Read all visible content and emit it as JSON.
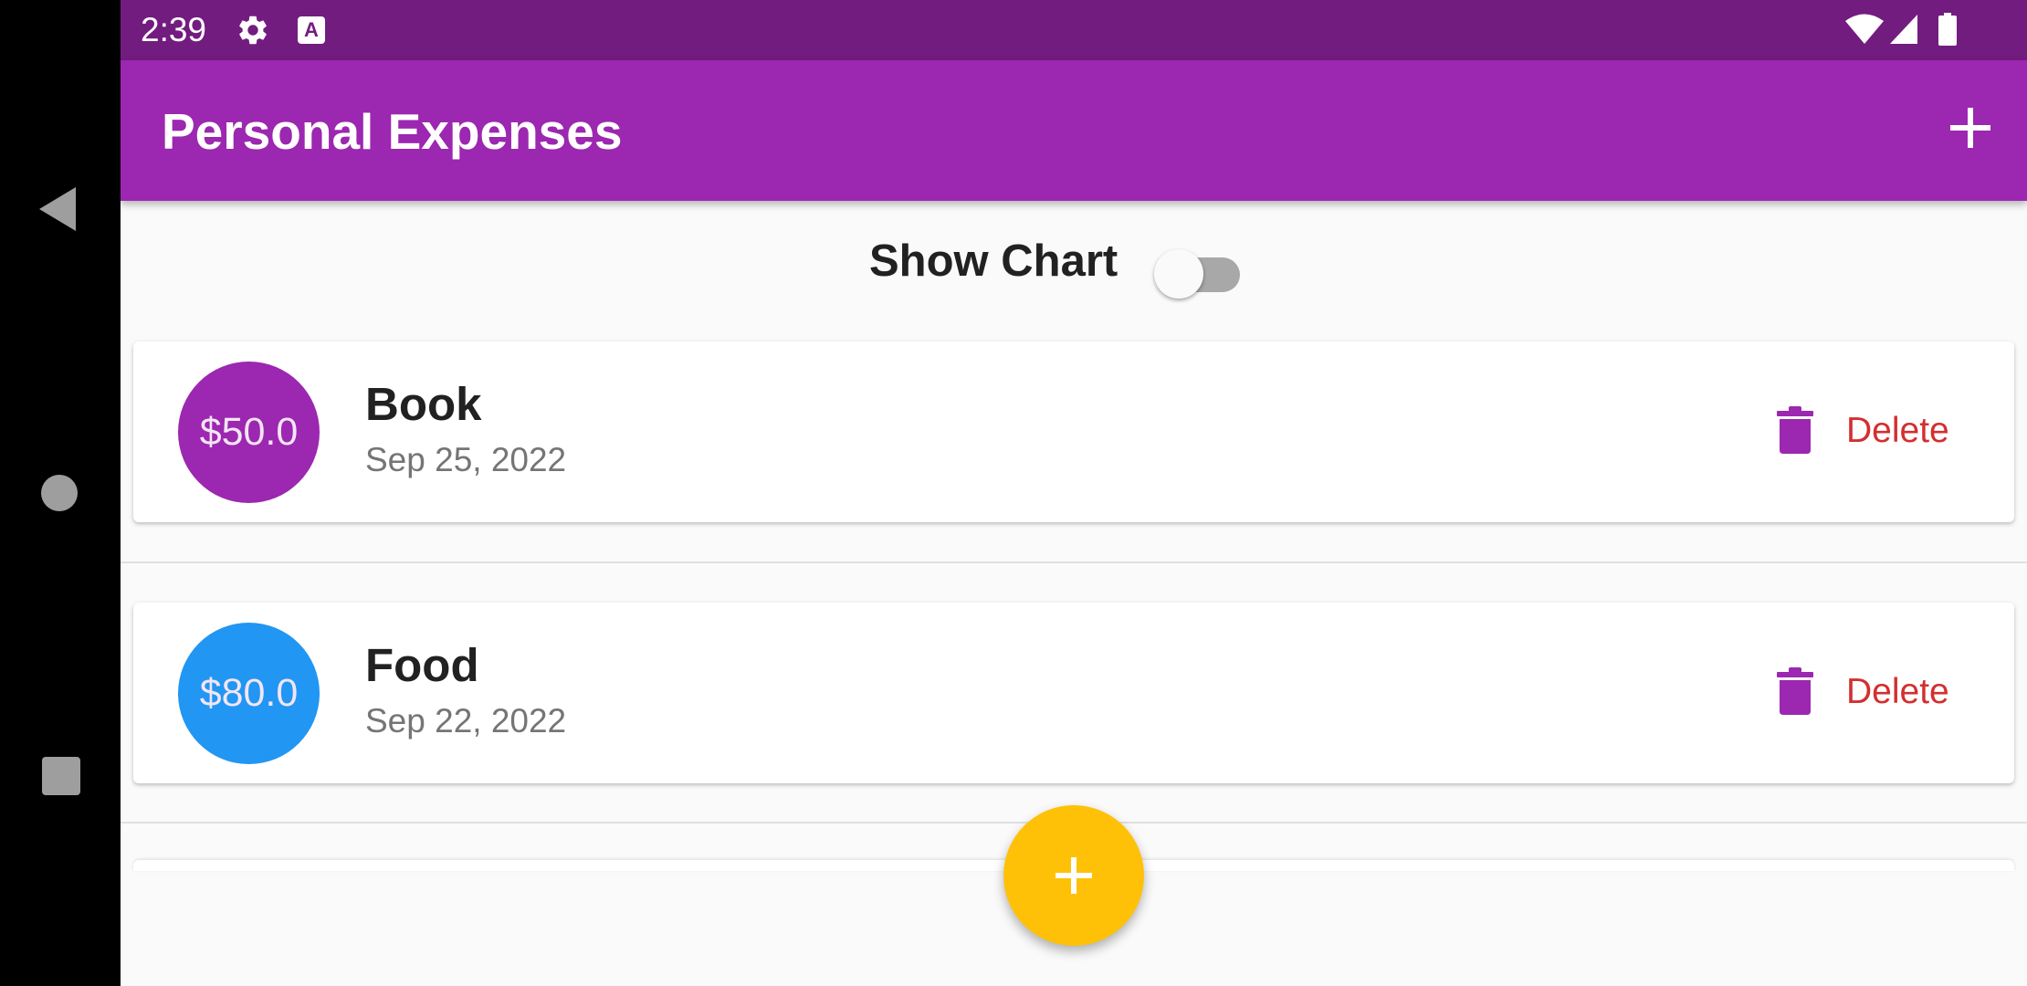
{
  "status_bar": {
    "time": "2:39",
    "a_badge": "A",
    "icons": [
      "gear-icon",
      "a-badge-icon",
      "wifi-icon",
      "signal-icon",
      "battery-icon"
    ]
  },
  "app_bar": {
    "title": "Personal Expenses",
    "action_icon": "plus-icon"
  },
  "toggle": {
    "label": "Show Chart",
    "on": false
  },
  "transactions": [
    {
      "amount": "$50.0",
      "title": "Book",
      "date": "Sep 25, 2022",
      "avatar_color": "#9c27b0",
      "delete_label": "Delete"
    },
    {
      "amount": "$80.0",
      "title": "Food",
      "date": "Sep 22, 2022",
      "avatar_color": "#2196f3",
      "delete_label": "Delete"
    }
  ],
  "fab": {
    "icon": "plus-icon",
    "color": "#ffc107"
  },
  "colors": {
    "primary": "#9c27b0",
    "status_bar": "#731c80",
    "accent": "#ffc107",
    "delete_text": "#d32f2f"
  },
  "system_nav": [
    "back-icon",
    "home-icon",
    "recents-icon"
  ]
}
